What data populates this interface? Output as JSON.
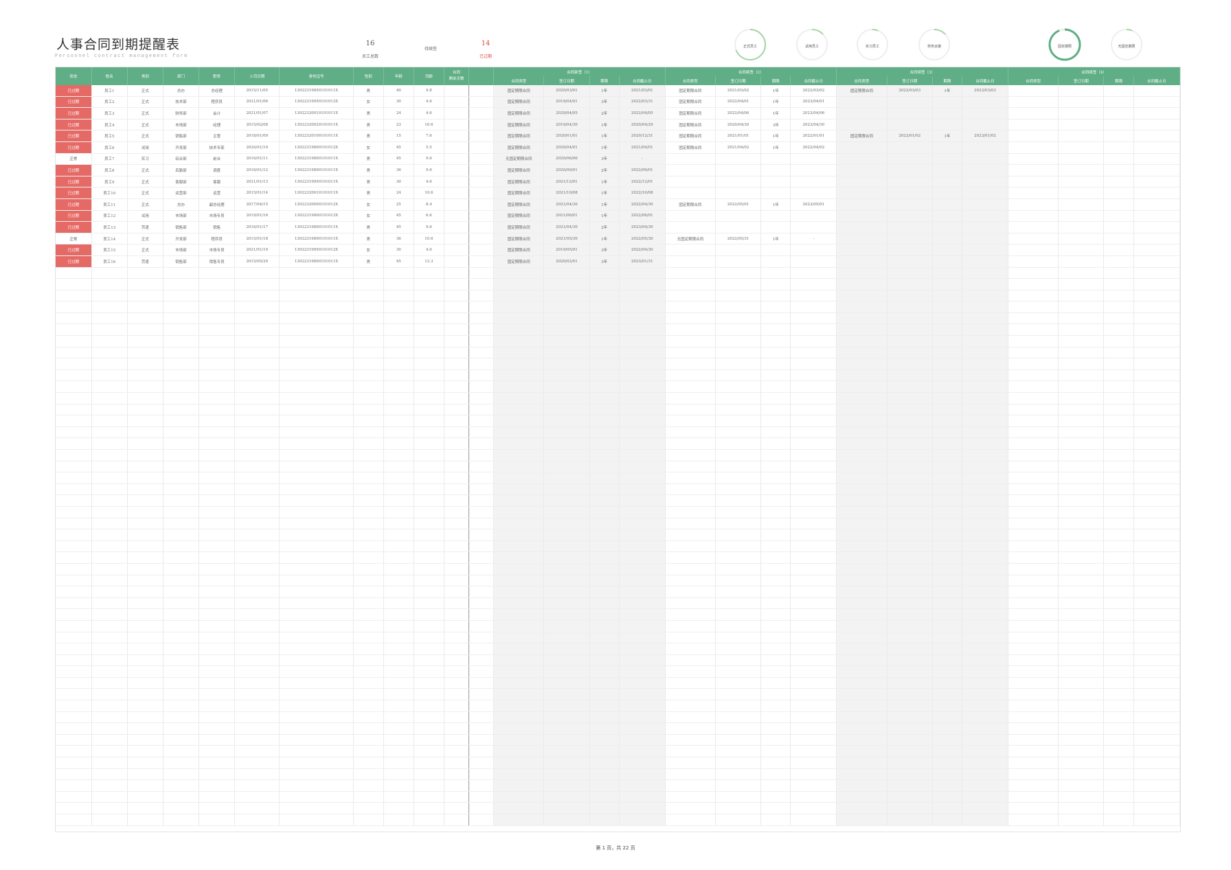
{
  "header": {
    "title": "人事合同到期提醒表",
    "subtitle": "Personnel contract management form",
    "stats": [
      {
        "value": "16",
        "label": "员工总数"
      },
      {
        "value": "",
        "label": "待续签"
      },
      {
        "value": "14",
        "label": "已过期"
      }
    ],
    "accent_color": "#5fae85",
    "expired_color": "#e56a66"
  },
  "rings": [
    {
      "label": "正式员工",
      "fraction": 0.69
    },
    {
      "label": "试用员工",
      "fraction": 0.13
    },
    {
      "label": "实习员工",
      "fraction": 0.06
    },
    {
      "label": "劳务派遣",
      "fraction": 0.13
    },
    {
      "label": "固定期限",
      "fraction": 0.94
    },
    {
      "label": "无固定期限",
      "fraction": 0.06
    }
  ],
  "table": {
    "headers_top": {
      "status": "状态",
      "name": "姓名",
      "type": "类别",
      "dept": "部门",
      "position": "职务",
      "join_date": "入司日期",
      "id": "身份证号",
      "gender": "性别",
      "age": "年龄",
      "tenure": "司龄",
      "days_line1": "合同",
      "days_line2": "剩余天数",
      "c1": "合同新签（1）",
      "c2": "合同续签（2）",
      "c3": "合同续签（3）",
      "c4": "合同续签（4）"
    },
    "sub_headers": [
      "合同类型",
      "签订日期",
      "期限",
      "合同截止日"
    ],
    "rows": [
      {
        "status": "已过期",
        "name": "员工1",
        "type": "正式",
        "dept": "总办",
        "pos": "总经理",
        "join": "2015/11/05",
        "id": "13022319850101011X",
        "sex": "男",
        "age": "40",
        "ten": "9.8",
        "days": "",
        "c": [
          [
            "固定期限合同",
            "2020/03/01",
            "1年",
            "2021/03/01"
          ],
          [
            "固定期限合同",
            "2021/03/02",
            "1年",
            "2022/03/02"
          ],
          [
            "固定期限合同",
            "2022/03/03",
            "1年",
            "2023/03/03"
          ],
          [
            "",
            "",
            "",
            ""
          ]
        ]
      },
      {
        "status": "已过期",
        "name": "员工2",
        "type": "正式",
        "dept": "技术部",
        "pos": "程序员",
        "join": "2021/01/06",
        "id": "13022319950101012X",
        "sex": "女",
        "age": "30",
        "ten": "4.6",
        "days": "",
        "c": [
          [
            "固定期限合同",
            "2019/04/01",
            "3年",
            "2022/03/31"
          ],
          [
            "固定期限合同",
            "2022/04/01",
            "1年",
            "2023/04/01"
          ],
          [
            "",
            "",
            "",
            ""
          ],
          [
            "",
            "",
            "",
            ""
          ]
        ]
      },
      {
        "status": "已过期",
        "name": "员工3",
        "type": "正式",
        "dept": "财务部",
        "pos": "会计",
        "join": "2021/01/07",
        "id": "13022320010101011X",
        "sex": "男",
        "age": "24",
        "ten": "4.6",
        "days": "",
        "c": [
          [
            "固定期限合同",
            "2020/04/05",
            "2年",
            "2022/04/05"
          ],
          [
            "固定期限合同",
            "2022/04/06",
            "1年",
            "2023/04/06"
          ],
          [
            "",
            "",
            "",
            ""
          ],
          [
            "",
            "",
            "",
            ""
          ]
        ]
      },
      {
        "status": "已过期",
        "name": "员工4",
        "type": "正式",
        "dept": "市场部",
        "pos": "经理",
        "join": "2015/02/08",
        "id": "13022320020101011X",
        "sex": "男",
        "age": "23",
        "ten": "10.6",
        "days": "",
        "c": [
          [
            "固定期限合同",
            "2019/04/30",
            "1年",
            "2020/04/29"
          ],
          [
            "固定期限合同",
            "2020/04/30",
            "3年",
            "2023/04/30"
          ],
          [
            "",
            "",
            "",
            ""
          ],
          [
            "",
            "",
            "",
            ""
          ]
        ]
      },
      {
        "status": "已过期",
        "name": "员工5",
        "type": "正式",
        "dept": "销售部",
        "pos": "主管",
        "join": "2018/01/09",
        "id": "13022320100101011X",
        "sex": "男",
        "age": "15",
        "ten": "7.6",
        "days": "",
        "c": [
          [
            "固定期限合同",
            "2020/01/01",
            "1年",
            "2020/12/31"
          ],
          [
            "固定期限合同",
            "2021/01/01",
            "1年",
            "2022/01/01"
          ],
          [
            "固定期限合同",
            "2022/01/02",
            "1年",
            "2023/01/02"
          ],
          [
            "",
            "",
            "",
            ""
          ]
        ]
      },
      {
        "status": "已过期",
        "name": "员工6",
        "type": "试用",
        "dept": "开发部",
        "pos": "技术专家",
        "join": "2020/01/10",
        "id": "13022319800101012X",
        "sex": "女",
        "age": "45",
        "ten": "5.5",
        "days": "",
        "c": [
          [
            "固定期限合同",
            "2020/04/01",
            "1年",
            "2021/04/01"
          ],
          [
            "固定期限合同",
            "2021/04/02",
            "1年",
            "2022/04/02"
          ],
          [
            "",
            "",
            "",
            ""
          ],
          [
            "",
            "",
            "",
            ""
          ]
        ]
      },
      {
        "status": "正常",
        "name": "员工7",
        "type": "实习",
        "dept": "综合部",
        "pos": "前台",
        "join": "2016/01/11",
        "id": "13022319800101011X",
        "sex": "男",
        "age": "45",
        "ten": "9.6",
        "days": "",
        "c": [
          [
            "无固定期限合同",
            "2020/06/06",
            "3年",
            "-"
          ],
          [
            "",
            "",
            "",
            ""
          ],
          [
            "",
            "",
            "",
            ""
          ],
          [
            "",
            "",
            "",
            ""
          ]
        ]
      },
      {
        "status": "已过期",
        "name": "员工8",
        "type": "正式",
        "dept": "后勤部",
        "pos": "调度",
        "join": "2016/01/12",
        "id": "13022319890101011X",
        "sex": "男",
        "age": "36",
        "ten": "9.6",
        "days": "",
        "c": [
          [
            "固定期限合同",
            "2020/09/01",
            "2年",
            "2022/09/01"
          ],
          [
            "",
            "",
            "",
            ""
          ],
          [
            "",
            "",
            "",
            ""
          ],
          [
            "",
            "",
            "",
            ""
          ]
        ]
      },
      {
        "status": "已过期",
        "name": "员工9",
        "type": "正式",
        "dept": "客服部",
        "pos": "客服",
        "join": "2021/01/13",
        "id": "13022319950101011X",
        "sex": "男",
        "age": "30",
        "ten": "4.6",
        "days": "",
        "c": [
          [
            "固定期限合同",
            "2021/12/01",
            "1年",
            "2022/12/01"
          ],
          [
            "",
            "",
            "",
            ""
          ],
          [
            "",
            "",
            "",
            ""
          ],
          [
            "",
            "",
            "",
            ""
          ]
        ]
      },
      {
        "status": "已过期",
        "name": "员工10",
        "type": "正式",
        "dept": "运营部",
        "pos": "运营",
        "join": "2015/01/14",
        "id": "13022320010101011X",
        "sex": "男",
        "age": "24",
        "ten": "10.6",
        "days": "",
        "c": [
          [
            "固定期限合同",
            "2021/10/08",
            "1年",
            "2022/10/08"
          ],
          [
            "",
            "",
            "",
            ""
          ],
          [
            "",
            "",
            "",
            ""
          ],
          [
            "",
            "",
            "",
            ""
          ]
        ]
      },
      {
        "status": "已过期",
        "name": "员工11",
        "type": "正式",
        "dept": "总办",
        "pos": "副总经理",
        "join": "2017/04/15",
        "id": "13022320000101012X",
        "sex": "女",
        "age": "25",
        "ten": "8.4",
        "days": "",
        "c": [
          [
            "固定期限合同",
            "2021/04/30",
            "1年",
            "2022/04/30"
          ],
          [
            "固定期限合同",
            "2022/05/01",
            "1年",
            "2023/05/01"
          ],
          [
            "",
            "",
            "",
            ""
          ],
          [
            "",
            "",
            "",
            ""
          ]
        ]
      },
      {
        "status": "已过期",
        "name": "员工12",
        "type": "试用",
        "dept": "市场部",
        "pos": "市场专员",
        "join": "2019/01/16",
        "id": "13022319800101012X",
        "sex": "女",
        "age": "45",
        "ten": "6.6",
        "days": "",
        "c": [
          [
            "固定期限合同",
            "2021/06/01",
            "1年",
            "2022/06/01"
          ],
          [
            "",
            "",
            "",
            ""
          ],
          [
            "",
            "",
            "",
            ""
          ],
          [
            "",
            "",
            "",
            ""
          ]
        ]
      },
      {
        "status": "已过期",
        "name": "员工13",
        "type": "劳遣",
        "dept": "销售部",
        "pos": "销售",
        "join": "2016/01/17",
        "id": "13022319800101011X",
        "sex": "男",
        "age": "45",
        "ten": "9.6",
        "days": "",
        "c": [
          [
            "固定期限合同",
            "2021/04/30",
            "2年",
            "2023/04/30"
          ],
          [
            "",
            "",
            "",
            ""
          ],
          [
            "",
            "",
            "",
            ""
          ],
          [
            "",
            "",
            "",
            ""
          ]
        ]
      },
      {
        "status": "正常",
        "name": "员工14",
        "type": "正式",
        "dept": "开发部",
        "pos": "程序员",
        "join": "2015/01/18",
        "id": "13022319890101011X",
        "sex": "男",
        "age": "36",
        "ten": "10.6",
        "days": "",
        "c": [
          [
            "固定期限合同",
            "2021/05/30",
            "1年",
            "2022/05/30"
          ],
          [
            "无固定期限合同",
            "2022/05/31",
            "1年",
            "-"
          ],
          [
            "",
            "",
            "",
            ""
          ],
          [
            "",
            "",
            "",
            ""
          ]
        ]
      },
      {
        "status": "已过期",
        "name": "员工15",
        "type": "正式",
        "dept": "市场部",
        "pos": "市场专员",
        "join": "2021/01/19",
        "id": "13022319950101012X",
        "sex": "女",
        "age": "30",
        "ten": "4.6",
        "days": "",
        "c": [
          [
            "固定期限合同",
            "2019/05/01",
            "3年",
            "2022/04/30"
          ],
          [
            "",
            "",
            "",
            ""
          ],
          [
            "",
            "",
            "",
            ""
          ],
          [
            "",
            "",
            "",
            ""
          ]
        ]
      },
      {
        "status": "已过期",
        "name": "员工16",
        "type": "劳遣",
        "dept": "销售部",
        "pos": "销售专员",
        "join": "2015/05/20",
        "id": "13022319800101011X",
        "sex": "男",
        "age": "45",
        "ten": "12.3",
        "days": "",
        "c": [
          [
            "固定期限合同",
            "2020/02/01",
            "3年",
            "2023/01/31"
          ],
          [
            "",
            "",
            "",
            ""
          ],
          [
            "",
            "",
            "",
            ""
          ],
          [
            "",
            "",
            "",
            ""
          ]
        ]
      }
    ]
  },
  "footer": {
    "page_text": "第 1 页，共 22 页"
  }
}
